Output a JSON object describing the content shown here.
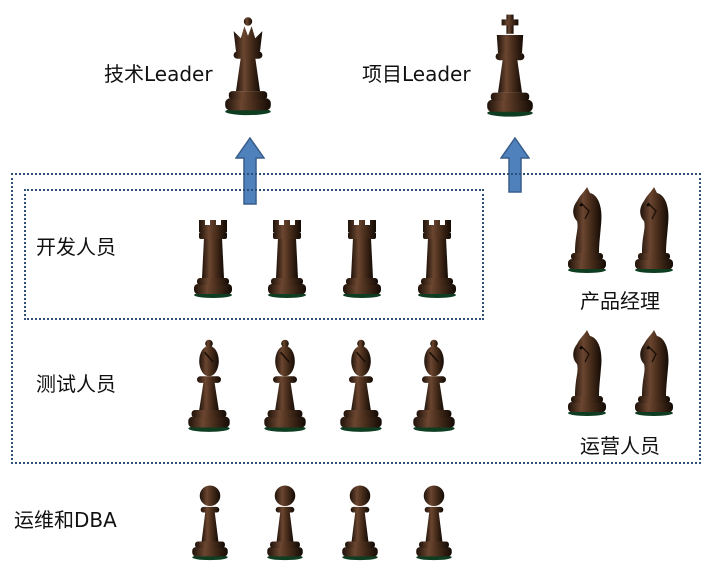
{
  "leaders": {
    "tech": "技术Leader",
    "project": "项目Leader"
  },
  "groups": {
    "developers": "开发人员",
    "testers": "测试人员",
    "ops_dba": "运维和DBA",
    "product_managers": "产品经理",
    "operations": "运营人员"
  },
  "colors": {
    "box_border": "#2e4f7a",
    "arrow_fill": "#4f81bd",
    "arrow_stroke": "#385d8a",
    "piece_wood": "#4a2e1c"
  },
  "pieces": {
    "leader_tech": "queen",
    "leader_project": "king",
    "developers": "rook",
    "testers": "bishop",
    "ops_dba": "pawn",
    "product_managers": "knight",
    "operations": "knight"
  }
}
